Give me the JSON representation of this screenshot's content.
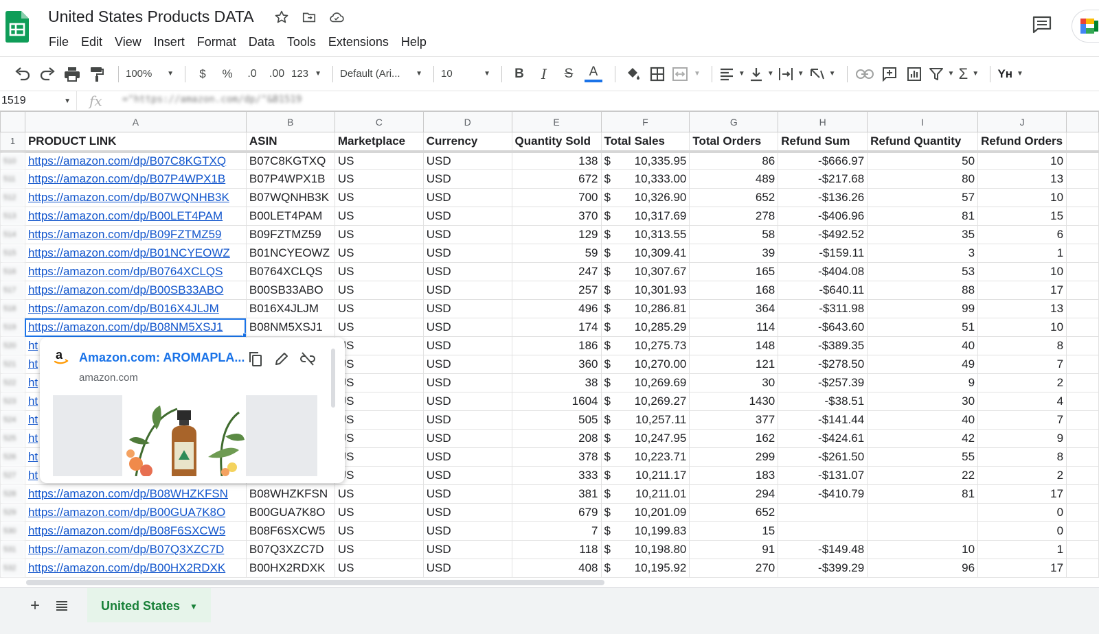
{
  "title_bar": {
    "doc_title": "United States Products DATA",
    "menu": [
      "File",
      "Edit",
      "View",
      "Insert",
      "Format",
      "Data",
      "Tools",
      "Extensions",
      "Help"
    ]
  },
  "toolbar": {
    "zoom": "100%",
    "currency_symbol": "$",
    "percent_symbol": "%",
    "decrease_decimal": ".0",
    "increase_decimal": ".00",
    "more_formats": "123",
    "font": "Default (Ari...",
    "font_size": "10",
    "bold_label": "B",
    "italic_label": "I",
    "strike_label": "S",
    "text_color_label": "A",
    "input_tools_label": "Yн"
  },
  "formula_bar": {
    "cell_ref": "1519",
    "formula": "=\"https://amazon.com/dp/\"&B1519"
  },
  "grid": {
    "column_letters": [
      "A",
      "B",
      "C",
      "D",
      "E",
      "F",
      "G",
      "H",
      "I",
      "J"
    ],
    "header_row_number": "1",
    "headers": [
      "PRODUCT LINK",
      "ASIN",
      "Marketplace",
      "Currency",
      "Quantity Sold",
      "Total Sales",
      "Total Orders",
      "Refund Sum",
      "Refund Quantity",
      "Refund Orders"
    ],
    "rows": [
      {
        "num": "510",
        "link": "https://amazon.com/dp/B07C8KGTXQ",
        "asin": "B07C8KGTXQ",
        "market": "US",
        "currency": "USD",
        "qty": "138",
        "cur": "$",
        "sales": "10,335.95",
        "orders": "86",
        "refund_sum": "-$666.97",
        "refund_qty": "50",
        "refund_orders": "10"
      },
      {
        "num": "511",
        "link": "https://amazon.com/dp/B07P4WPX1B",
        "asin": "B07P4WPX1B",
        "market": "US",
        "currency": "USD",
        "qty": "672",
        "cur": "$",
        "sales": "10,333.00",
        "orders": "489",
        "refund_sum": "-$217.68",
        "refund_qty": "80",
        "refund_orders": "13"
      },
      {
        "num": "512",
        "link": "https://amazon.com/dp/B07WQNHB3K",
        "asin": "B07WQNHB3K",
        "market": "US",
        "currency": "USD",
        "qty": "700",
        "cur": "$",
        "sales": "10,326.90",
        "orders": "652",
        "refund_sum": "-$136.26",
        "refund_qty": "57",
        "refund_orders": "10"
      },
      {
        "num": "513",
        "link": "https://amazon.com/dp/B00LET4PAM",
        "asin": "B00LET4PAM",
        "market": "US",
        "currency": "USD",
        "qty": "370",
        "cur": "$",
        "sales": "10,317.69",
        "orders": "278",
        "refund_sum": "-$406.96",
        "refund_qty": "81",
        "refund_orders": "15"
      },
      {
        "num": "514",
        "link": "https://amazon.com/dp/B09FZTMZ59",
        "asin": "B09FZTMZ59",
        "market": "US",
        "currency": "USD",
        "qty": "129",
        "cur": "$",
        "sales": "10,313.55",
        "orders": "58",
        "refund_sum": "-$492.52",
        "refund_qty": "35",
        "refund_orders": "6"
      },
      {
        "num": "515",
        "link": "https://amazon.com/dp/B01NCYEOWZ",
        "asin": "B01NCYEOWZ",
        "market": "US",
        "currency": "USD",
        "qty": "59",
        "cur": "$",
        "sales": "10,309.41",
        "orders": "39",
        "refund_sum": "-$159.11",
        "refund_qty": "3",
        "refund_orders": "1"
      },
      {
        "num": "516",
        "link": "https://amazon.com/dp/B0764XCLQS",
        "asin": "B0764XCLQS",
        "market": "US",
        "currency": "USD",
        "qty": "247",
        "cur": "$",
        "sales": "10,307.67",
        "orders": "165",
        "refund_sum": "-$404.08",
        "refund_qty": "53",
        "refund_orders": "10"
      },
      {
        "num": "517",
        "link": "https://amazon.com/dp/B00SB33ABO",
        "asin": "B00SB33ABO",
        "market": "US",
        "currency": "USD",
        "qty": "257",
        "cur": "$",
        "sales": "10,301.93",
        "orders": "168",
        "refund_sum": "-$640.11",
        "refund_qty": "88",
        "refund_orders": "17"
      },
      {
        "num": "518",
        "link": "https://amazon.com/dp/B016X4JLJM",
        "asin": "B016X4JLJM",
        "market": "US",
        "currency": "USD",
        "qty": "496",
        "cur": "$",
        "sales": "10,286.81",
        "orders": "364",
        "refund_sum": "-$311.98",
        "refund_qty": "99",
        "refund_orders": "13"
      },
      {
        "num": "519",
        "link": "https://amazon.com/dp/B08NM5XSJ1",
        "asin": "B08NM5XSJ1",
        "market": "US",
        "currency": "USD",
        "qty": "174",
        "cur": "$",
        "sales": "10,285.29",
        "orders": "114",
        "refund_sum": "-$643.60",
        "refund_qty": "51",
        "refund_orders": "10"
      },
      {
        "num": "520",
        "link": "ht",
        "asin": "",
        "market": "US",
        "currency": "USD",
        "qty": "186",
        "cur": "$",
        "sales": "10,275.73",
        "orders": "148",
        "refund_sum": "-$389.35",
        "refund_qty": "40",
        "refund_orders": "8"
      },
      {
        "num": "521",
        "link": "ht",
        "asin": "",
        "market": "US",
        "currency": "USD",
        "qty": "360",
        "cur": "$",
        "sales": "10,270.00",
        "orders": "121",
        "refund_sum": "-$278.50",
        "refund_qty": "49",
        "refund_orders": "7"
      },
      {
        "num": "522",
        "link": "ht",
        "asin": "",
        "market": "US",
        "currency": "USD",
        "qty": "38",
        "cur": "$",
        "sales": "10,269.69",
        "orders": "30",
        "refund_sum": "-$257.39",
        "refund_qty": "9",
        "refund_orders": "2"
      },
      {
        "num": "523",
        "link": "ht",
        "asin": "",
        "market": "US",
        "currency": "USD",
        "qty": "1604",
        "cur": "$",
        "sales": "10,269.27",
        "orders": "1430",
        "refund_sum": "-$38.51",
        "refund_qty": "30",
        "refund_orders": "4"
      },
      {
        "num": "524",
        "link": "ht",
        "asin": "",
        "market": "US",
        "currency": "USD",
        "qty": "505",
        "cur": "$",
        "sales": "10,257.11",
        "orders": "377",
        "refund_sum": "-$141.44",
        "refund_qty": "40",
        "refund_orders": "7"
      },
      {
        "num": "525",
        "link": "ht",
        "asin": "",
        "market": "US",
        "currency": "USD",
        "qty": "208",
        "cur": "$",
        "sales": "10,247.95",
        "orders": "162",
        "refund_sum": "-$424.61",
        "refund_qty": "42",
        "refund_orders": "9"
      },
      {
        "num": "526",
        "link": "ht",
        "asin": "",
        "market": "US",
        "currency": "USD",
        "qty": "378",
        "cur": "$",
        "sales": "10,223.71",
        "orders": "299",
        "refund_sum": "-$261.50",
        "refund_qty": "55",
        "refund_orders": "8"
      },
      {
        "num": "527",
        "link": "ht",
        "asin": "",
        "market": "US",
        "currency": "USD",
        "qty": "333",
        "cur": "$",
        "sales": "10,211.17",
        "orders": "183",
        "refund_sum": "-$131.07",
        "refund_qty": "22",
        "refund_orders": "2"
      },
      {
        "num": "528",
        "link": "https://amazon.com/dp/B08WHZKFSN",
        "asin": "B08WHZKFSN",
        "market": "US",
        "currency": "USD",
        "qty": "381",
        "cur": "$",
        "sales": "10,211.01",
        "orders": "294",
        "refund_sum": "-$410.79",
        "refund_qty": "81",
        "refund_orders": "17"
      },
      {
        "num": "529",
        "link": "https://amazon.com/dp/B00GUA7K8O",
        "asin": "B00GUA7K8O",
        "market": "US",
        "currency": "USD",
        "qty": "679",
        "cur": "$",
        "sales": "10,201.09",
        "orders": "652",
        "refund_sum": "",
        "refund_qty": "",
        "refund_orders": "0"
      },
      {
        "num": "530",
        "link": "https://amazon.com/dp/B08F6SXCW5",
        "asin": "B08F6SXCW5",
        "market": "US",
        "currency": "USD",
        "qty": "7",
        "cur": "$",
        "sales": "10,199.83",
        "orders": "15",
        "refund_sum": "",
        "refund_qty": "",
        "refund_orders": "0"
      },
      {
        "num": "531",
        "link": "https://amazon.com/dp/B07Q3XZC7D",
        "asin": "B07Q3XZC7D",
        "market": "US",
        "currency": "USD",
        "qty": "118",
        "cur": "$",
        "sales": "10,198.80",
        "orders": "91",
        "refund_sum": "-$149.48",
        "refund_qty": "10",
        "refund_orders": "1"
      },
      {
        "num": "532",
        "link": "https://amazon.com/dp/B00HX2RDXK",
        "asin": "B00HX2RDXK",
        "market": "US",
        "currency": "USD",
        "qty": "408",
        "cur": "$",
        "sales": "10,195.92",
        "orders": "270",
        "refund_sum": "-$399.29",
        "refund_qty": "96",
        "refund_orders": "17"
      }
    ],
    "selected_row_index": 9
  },
  "link_preview": {
    "title": "Amazon.com: AROMAPLA...",
    "domain": "amazon.com",
    "favicon_letter": "a"
  },
  "sheet_tabs": {
    "active_tab": "United States"
  },
  "colors": {
    "link": "#1155cc",
    "selection": "#1a73e8",
    "sheets_green": "#188038",
    "active_tab_bg": "#e6f4ea"
  },
  "icons": [
    "undo-icon",
    "redo-icon",
    "print-icon",
    "paint-format-icon",
    "fill-color-icon",
    "borders-icon",
    "merge-cells-icon",
    "align-horizontal-icon",
    "align-vertical-icon",
    "text-wrap-icon",
    "text-rotation-icon",
    "link-icon",
    "comment-icon",
    "chart-icon",
    "filter-icon",
    "functions-icon",
    "star-icon",
    "move-icon",
    "cloud-status-icon",
    "comments-icon",
    "meet-icon",
    "copy-link-icon",
    "edit-link-icon",
    "remove-link-icon",
    "add-sheet-icon",
    "all-sheets-icon"
  ]
}
